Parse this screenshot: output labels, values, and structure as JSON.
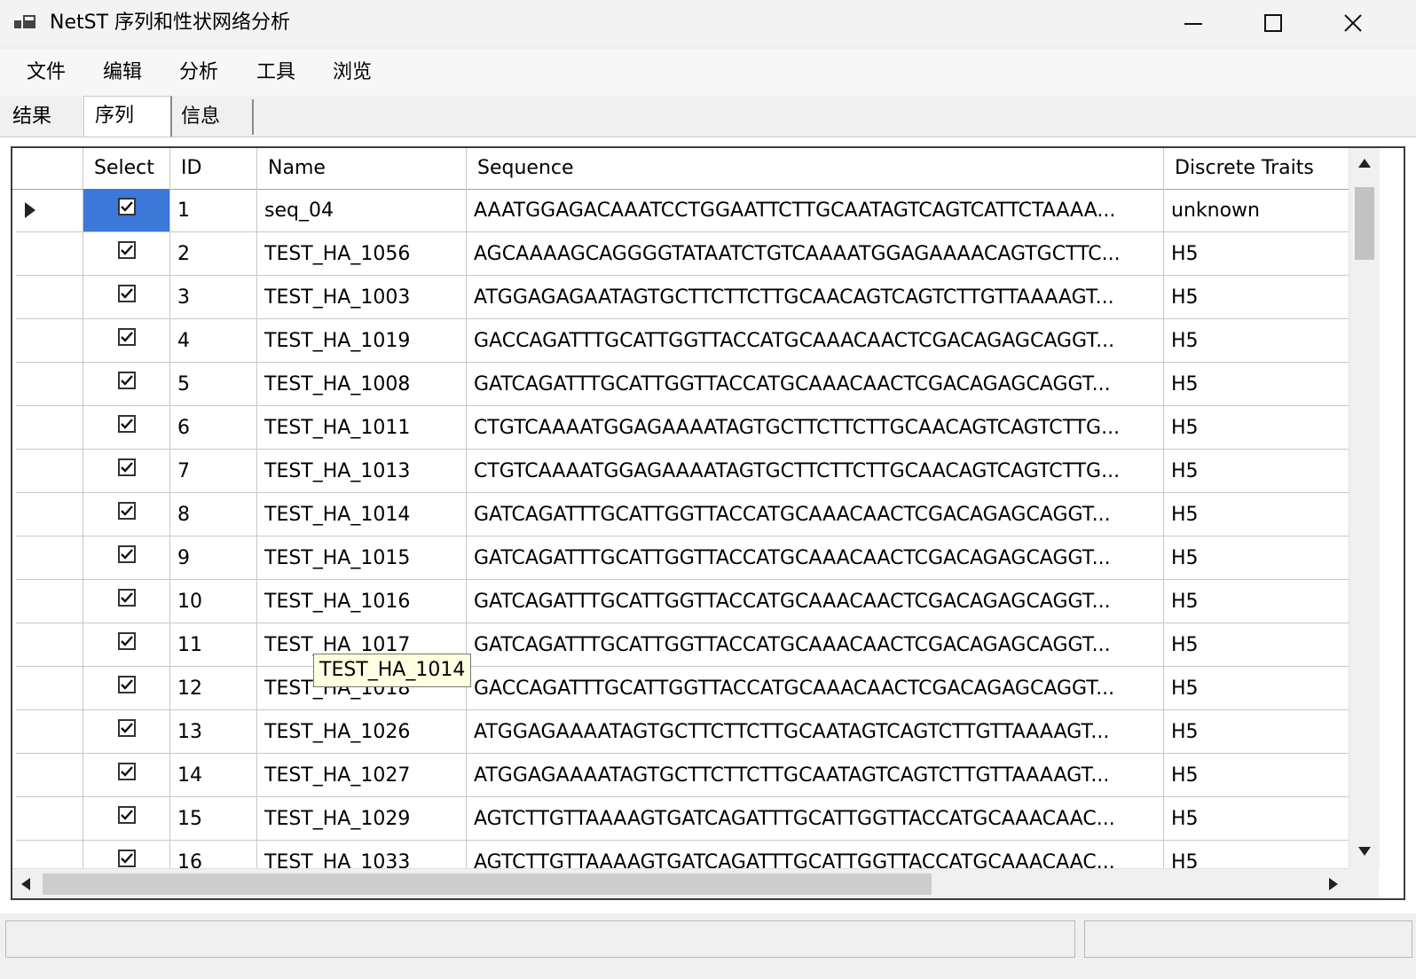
{
  "window": {
    "title": "NetST 序列和性状网络分析"
  },
  "menu": [
    "文件",
    "编辑",
    "分析",
    "工具",
    "浏览"
  ],
  "tabs": [
    {
      "label": "结果",
      "active": false
    },
    {
      "label": "序列",
      "active": true
    },
    {
      "label": "信息",
      "active": false
    }
  ],
  "grid": {
    "columns": [
      "Select",
      "ID",
      "Name",
      "Sequence",
      "Discrete Traits"
    ],
    "current_row": 0,
    "rows": [
      {
        "checked": true,
        "id": "1",
        "name": "seq_04",
        "sequence": "AAATGGAGACAAATCCTGGAATTCTTGCAATAGTCAGTCATTCTAAAA...",
        "trait": "unknown"
      },
      {
        "checked": true,
        "id": "2",
        "name": "TEST_HA_1056",
        "sequence": "AGCAAAAGCAGGGGTATAATCTGTCAAAATGGAGAAAACAGTGCTTC...",
        "trait": "H5"
      },
      {
        "checked": true,
        "id": "3",
        "name": "TEST_HA_1003",
        "sequence": "ATGGAGAGAATAGTGCTTCTTCTTGCAACAGTCAGTCTTGTTAAAAGT...",
        "trait": "H5"
      },
      {
        "checked": true,
        "id": "4",
        "name": "TEST_HA_1019",
        "sequence": "GACCAGATTTGCATTGGTTACCATGCAAACAACTCGACAGAGCAGGT...",
        "trait": "H5"
      },
      {
        "checked": true,
        "id": "5",
        "name": "TEST_HA_1008",
        "sequence": "GATCAGATTTGCATTGGTTACCATGCAAACAACTCGACAGAGCAGGT...",
        "trait": "H5"
      },
      {
        "checked": true,
        "id": "6",
        "name": "TEST_HA_1011",
        "sequence": "CTGTCAAAATGGAGAAAATAGTGCTTCTTCTTGCAACAGTCAGTCTTG...",
        "trait": "H5"
      },
      {
        "checked": true,
        "id": "7",
        "name": "TEST_HA_1013",
        "sequence": "CTGTCAAAATGGAGAAAATAGTGCTTCTTCTTGCAACAGTCAGTCTTG...",
        "trait": "H5"
      },
      {
        "checked": true,
        "id": "8",
        "name": "TEST_HA_1014",
        "sequence": "GATCAGATTTGCATTGGTTACCATGCAAACAACTCGACAGAGCAGGT...",
        "trait": "H5"
      },
      {
        "checked": true,
        "id": "9",
        "name": "TEST_HA_1015",
        "sequence": "GATCAGATTTGCATTGGTTACCATGCAAACAACTCGACAGAGCAGGT...",
        "trait": "H5"
      },
      {
        "checked": true,
        "id": "10",
        "name": "TEST_HA_1016",
        "sequence": "GATCAGATTTGCATTGGTTACCATGCAAACAACTCGACAGAGCAGGT...",
        "trait": "H5"
      },
      {
        "checked": true,
        "id": "11",
        "name": "TEST_HA_1017",
        "sequence": "GATCAGATTTGCATTGGTTACCATGCAAACAACTCGACAGAGCAGGT...",
        "trait": "H5"
      },
      {
        "checked": true,
        "id": "12",
        "name": "TEST_HA_1018",
        "sequence": "GACCAGATTTGCATTGGTTACCATGCAAACAACTCGACAGAGCAGGT...",
        "trait": "H5"
      },
      {
        "checked": true,
        "id": "13",
        "name": "TEST_HA_1026",
        "sequence": "ATGGAGAAAATAGTGCTTCTTCTTGCAATAGTCAGTCTTGTTAAAAGT...",
        "trait": "H5"
      },
      {
        "checked": true,
        "id": "14",
        "name": "TEST_HA_1027",
        "sequence": "ATGGAGAAAATAGTGCTTCTTCTTGCAATAGTCAGTCTTGTTAAAAGT...",
        "trait": "H5"
      },
      {
        "checked": true,
        "id": "15",
        "name": "TEST_HA_1029",
        "sequence": "AGTCTTGTTAAAAGTGATCAGATTTGCATTGGTTACCATGCAAACAAC...",
        "trait": "H5"
      },
      {
        "checked": true,
        "id": "16",
        "name": "TEST_HA_1033",
        "sequence": "AGTCTTGTTAAAAGTGATCAGATTTGCATTGGTTACCATGCAAACAAC...",
        "trait": "H5"
      }
    ]
  },
  "tooltip": {
    "text": "TEST_HA_1014"
  },
  "colors": {
    "selection": "#3b78d8",
    "tooltip_bg": "#ffffe1"
  }
}
